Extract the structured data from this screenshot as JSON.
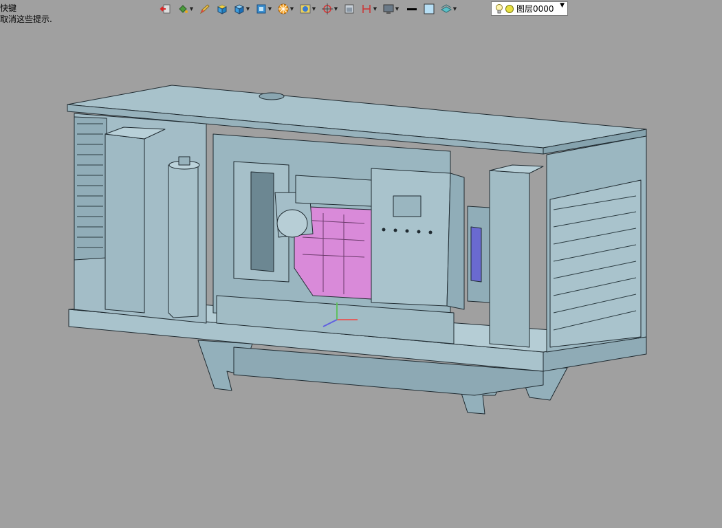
{
  "hint": {
    "line1": "快键",
    "line2": "取消这些提示."
  },
  "toolbar": {
    "tools": [
      {
        "name": "exit-tool-icon",
        "dropdown": false
      },
      {
        "name": "paint-bucket-icon",
        "dropdown": true
      },
      {
        "name": "pencil-icon",
        "dropdown": false
      },
      {
        "name": "solid-box-icon",
        "dropdown": false
      },
      {
        "name": "blue-cube-icon",
        "dropdown": true
      },
      {
        "name": "view-cube-icon",
        "dropdown": true
      },
      {
        "name": "render-wheel-icon",
        "dropdown": true
      },
      {
        "name": "display-mode-icon",
        "dropdown": true
      },
      {
        "name": "snap-target-icon",
        "dropdown": true
      },
      {
        "name": "frame-icon",
        "dropdown": false
      },
      {
        "name": "dimension-icon",
        "dropdown": true
      },
      {
        "name": "monitor-icon",
        "dropdown": true
      },
      {
        "name": "line-style-icon",
        "dropdown": false
      },
      {
        "name": "fill-color-icon",
        "dropdown": false
      },
      {
        "name": "layer-plane-icon",
        "dropdown": true
      }
    ]
  },
  "layer_select": {
    "value": "图层0000"
  },
  "colors": {
    "background": "#a0a0a0",
    "model_body": "#9bb7c1",
    "model_edge": "#1f2a30",
    "engine_highlight": "#d98ad9"
  }
}
